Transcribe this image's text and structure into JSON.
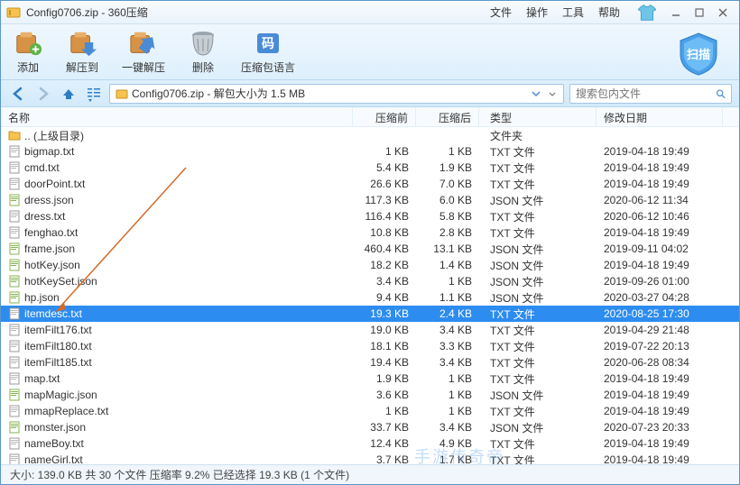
{
  "title": "Config0706.zip - 360压缩",
  "menu": {
    "file": "文件",
    "operation": "操作",
    "tools": "工具",
    "help": "帮助"
  },
  "toolbar": {
    "add": "添加",
    "extract": "解压到",
    "one_click": "一键解压",
    "delete": "删除",
    "lang": "压缩包语言",
    "scan": "扫描"
  },
  "nav": {
    "path_prefix": "Config0706.zip - 解包大小为 1.5 MB",
    "search_placeholder": "搜索包内文件"
  },
  "columns": {
    "name": "名称",
    "pre": "压缩前",
    "post": "压缩后",
    "type": "类型",
    "date": "修改日期"
  },
  "parent_dir": ".. (上级目录)",
  "folder_type": "文件夹",
  "files": [
    {
      "name": "bigmap.txt",
      "pre": "1 KB",
      "post": "1 KB",
      "type": "TXT 文件",
      "date": "2019-04-18 19:49",
      "ext": "txt"
    },
    {
      "name": "cmd.txt",
      "pre": "5.4 KB",
      "post": "1.9 KB",
      "type": "TXT 文件",
      "date": "2019-04-18 19:49",
      "ext": "txt"
    },
    {
      "name": "doorPoint.txt",
      "pre": "26.6 KB",
      "post": "7.0 KB",
      "type": "TXT 文件",
      "date": "2019-04-18 19:49",
      "ext": "txt"
    },
    {
      "name": "dress.json",
      "pre": "117.3 KB",
      "post": "6.0 KB",
      "type": "JSON 文件",
      "date": "2020-06-12 11:34",
      "ext": "json"
    },
    {
      "name": "dress.txt",
      "pre": "116.4 KB",
      "post": "5.8 KB",
      "type": "TXT 文件",
      "date": "2020-06-12 10:46",
      "ext": "txt"
    },
    {
      "name": "fenghao.txt",
      "pre": "10.8 KB",
      "post": "2.8 KB",
      "type": "TXT 文件",
      "date": "2019-04-18 19:49",
      "ext": "txt"
    },
    {
      "name": "frame.json",
      "pre": "460.4 KB",
      "post": "13.1 KB",
      "type": "JSON 文件",
      "date": "2019-09-11 04:02",
      "ext": "json"
    },
    {
      "name": "hotKey.json",
      "pre": "18.2 KB",
      "post": "1.4 KB",
      "type": "JSON 文件",
      "date": "2019-04-18 19:49",
      "ext": "json"
    },
    {
      "name": "hotKeySet.json",
      "pre": "3.4 KB",
      "post": "1 KB",
      "type": "JSON 文件",
      "date": "2019-09-26 01:00",
      "ext": "json"
    },
    {
      "name": "hp.json",
      "pre": "9.4 KB",
      "post": "1.1 KB",
      "type": "JSON 文件",
      "date": "2020-03-27 04:28",
      "ext": "json"
    },
    {
      "name": "itemdesc.txt",
      "pre": "19.3 KB",
      "post": "2.4 KB",
      "type": "TXT 文件",
      "date": "2020-08-25 17:30",
      "ext": "txt",
      "selected": true
    },
    {
      "name": "itemFilt176.txt",
      "pre": "19.0 KB",
      "post": "3.4 KB",
      "type": "TXT 文件",
      "date": "2019-04-29 21:48",
      "ext": "txt"
    },
    {
      "name": "itemFilt180.txt",
      "pre": "18.1 KB",
      "post": "3.3 KB",
      "type": "TXT 文件",
      "date": "2019-07-22 20:13",
      "ext": "txt"
    },
    {
      "name": "itemFilt185.txt",
      "pre": "19.4 KB",
      "post": "3.4 KB",
      "type": "TXT 文件",
      "date": "2020-06-28 08:34",
      "ext": "txt"
    },
    {
      "name": "map.txt",
      "pre": "1.9 KB",
      "post": "1 KB",
      "type": "TXT 文件",
      "date": "2019-04-18 19:49",
      "ext": "txt"
    },
    {
      "name": "mapMagic.json",
      "pre": "3.6 KB",
      "post": "1 KB",
      "type": "JSON 文件",
      "date": "2019-04-18 19:49",
      "ext": "json"
    },
    {
      "name": "mmapReplace.txt",
      "pre": "1 KB",
      "post": "1 KB",
      "type": "TXT 文件",
      "date": "2019-04-18 19:49",
      "ext": "txt"
    },
    {
      "name": "monster.json",
      "pre": "33.7 KB",
      "post": "3.4 KB",
      "type": "JSON 文件",
      "date": "2020-07-23 20:33",
      "ext": "json"
    },
    {
      "name": "nameBoy.txt",
      "pre": "12.4 KB",
      "post": "4.9 KB",
      "type": "TXT 文件",
      "date": "2019-04-18 19:49",
      "ext": "txt"
    },
    {
      "name": "nameGirl.txt",
      "pre": "3.7 KB",
      "post": "1.7 KB",
      "type": "TXT 文件",
      "date": "2019-04-18 19:49",
      "ext": "txt"
    }
  ],
  "status": "大小: 139.0 KB 共 30 个文件 压缩率 9.2% 已经选择 19.3 KB (1 个文件)",
  "watermark": "手游传奇帝"
}
